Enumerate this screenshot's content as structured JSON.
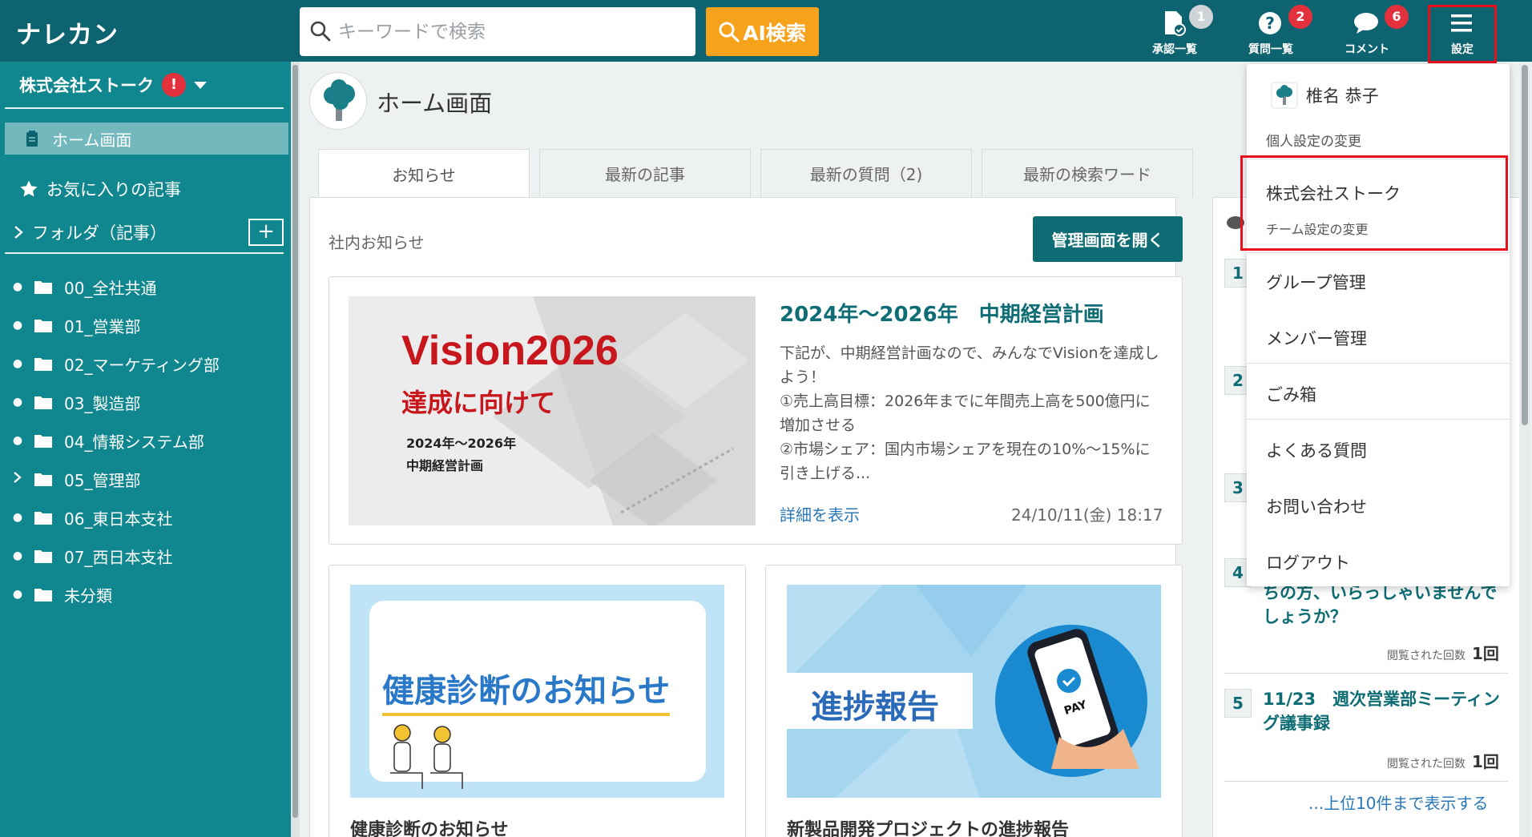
{
  "app": {
    "brand": "ナレカン"
  },
  "search": {
    "placeholder": "キーワードで検索",
    "ai_button": "AI検索"
  },
  "nav": [
    {
      "label": "承認一覧",
      "badge": "1",
      "icon": "document-check-icon"
    },
    {
      "label": "質問一覧",
      "badge": "2",
      "icon": "question-icon"
    },
    {
      "label": "コメント",
      "badge": "6",
      "icon": "comment-icon"
    },
    {
      "label": "設定",
      "icon": "hamburger-menu-icon"
    }
  ],
  "sidebar": {
    "company": "株式会社ストーク",
    "alert": "!",
    "home": "ホーム画面",
    "favorites": "お気に入りの記事",
    "folders_heading": "フォルダ（記事）",
    "add": "+",
    "folders": [
      {
        "name": "00_全社共通",
        "expand": "bullet"
      },
      {
        "name": "01_営業部",
        "expand": "bullet"
      },
      {
        "name": "02_マーケティング部",
        "expand": "bullet"
      },
      {
        "name": "03_製造部",
        "expand": "bullet"
      },
      {
        "name": "04_情報システム部",
        "expand": "bullet"
      },
      {
        "name": "05_管理部",
        "expand": "chevron"
      },
      {
        "name": "06_東日本支社",
        "expand": "bullet"
      },
      {
        "name": "07_西日本支社",
        "expand": "bullet"
      },
      {
        "name": "未分類",
        "expand": "bullet"
      }
    ]
  },
  "main": {
    "title": "ホーム画面",
    "tabs": [
      "お知らせ",
      "最新の記事",
      "最新の質問（2)",
      "最新の検索ワード"
    ],
    "section_label": "社内お知らせ",
    "admin_button": "管理画面を開く",
    "featured": {
      "image_title": "Vision2026",
      "image_subtitle": "達成に向けて",
      "image_line1": "2024年〜2026年",
      "image_line2": "中期経営計画",
      "title": "2024年〜2026年　中期経営計画",
      "body": "下記が、中期経営計画なので、みんなでVisionを達成しよう！\n①売上高目標：2026年までに年間売上高を500億円に増加させる\n②市場シェア：国内市場シェアを現在の10%〜15%に引き上げる...",
      "link": "詳細を表示",
      "date": "24/10/11(金) 18:17"
    },
    "cards": [
      {
        "image_text": "健康診断のお知らせ",
        "caption": "健康診断のお知らせ"
      },
      {
        "image_text": "進捗報告",
        "pay_label": "PAY",
        "caption": "新製品開発プロジェクトの進捗報告"
      }
    ]
  },
  "ranking": {
    "items": [
      {
        "rank": "1"
      },
      {
        "rank": "2"
      },
      {
        "rank": "3"
      },
      {
        "rank": "4",
        "title": "ちの方、いらっしゃいませんでしょうか？",
        "views_label": "閲覧された回数",
        "views": "1回"
      },
      {
        "rank": "5",
        "title": "11/23　週次営業部ミーティング議事録",
        "views_label": "閲覧された回数",
        "views": "1回"
      }
    ],
    "more": "...上位10件まで表示する"
  },
  "menu": {
    "user_name": "椎名 恭子",
    "personal_settings": "個人設定の変更",
    "company": "株式会社ストーク",
    "team_settings": "チーム設定の変更",
    "items": [
      "グループ管理",
      "メンバー管理",
      "ごみ箱",
      "よくある質問",
      "お問い合わせ",
      "ログアウト"
    ]
  },
  "colors": {
    "header": "#0d6370",
    "sidebar": "#10868f",
    "accent": "#f6a21b",
    "highlight": "#e8101c"
  }
}
